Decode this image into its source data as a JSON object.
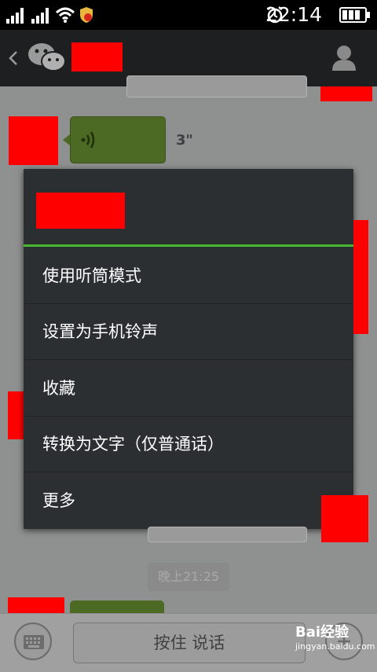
{
  "status_bar": {
    "time": "22:14"
  },
  "chat": {
    "voice_duration": "3\"",
    "timestamp": "晚上21:25"
  },
  "context_menu": {
    "items": [
      {
        "label": "使用听筒模式"
      },
      {
        "label": "设置为手机铃声"
      },
      {
        "label": "收藏"
      },
      {
        "label": "转换为文字（仅普通话）"
      },
      {
        "label": "更多"
      }
    ]
  },
  "input_bar": {
    "talk_label": "按住 说话"
  },
  "watermark": {
    "brand": "Bai经验",
    "url": "jingyan.baidu.com"
  },
  "colors": {
    "menu_accent": "#45b830",
    "voice_bubble": "#4c6a23"
  }
}
